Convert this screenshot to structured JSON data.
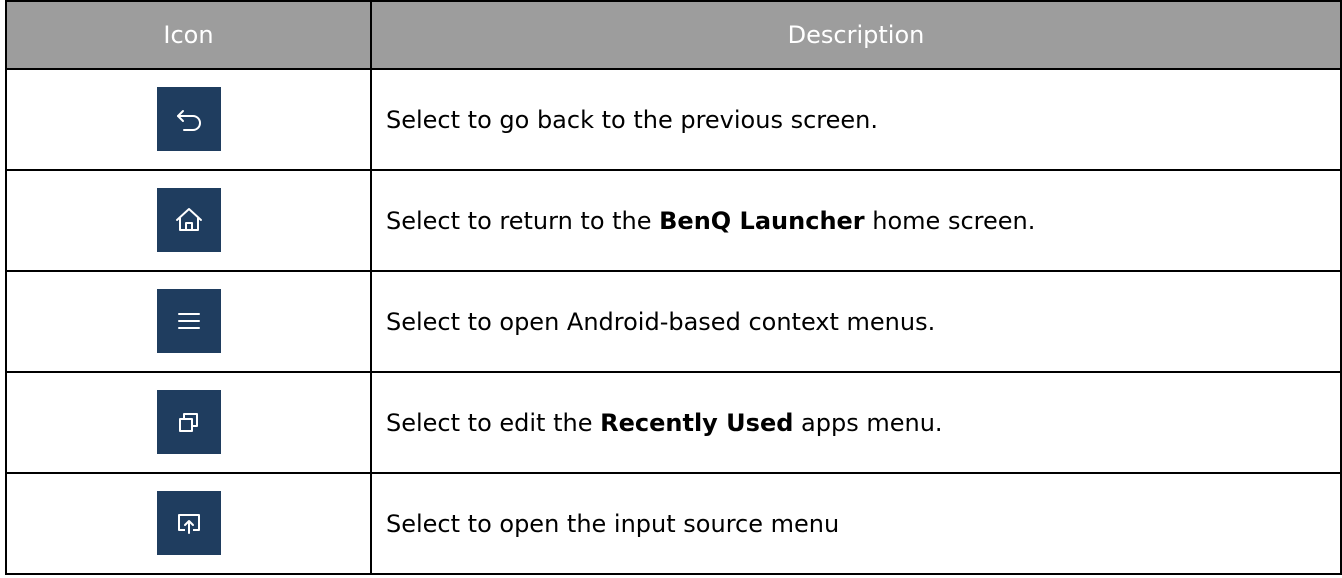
{
  "table": {
    "headers": {
      "icon": "Icon",
      "description": "Description"
    },
    "icon_bg_color": "#1f3d5f",
    "rows": [
      {
        "icon": "back-icon",
        "desc_pre": "Select to go back to the previous screen.",
        "desc_bold": "",
        "desc_post": ""
      },
      {
        "icon": "home-icon",
        "desc_pre": "Select to return to the ",
        "desc_bold": "BenQ Launcher",
        "desc_post": " home screen."
      },
      {
        "icon": "menu-icon",
        "desc_pre": "Select to open Android-based context menus.",
        "desc_bold": "",
        "desc_post": ""
      },
      {
        "icon": "recent-apps-icon",
        "desc_pre": "Select to edit the ",
        "desc_bold": "Recently Used",
        "desc_post": " apps menu."
      },
      {
        "icon": "input-source-icon",
        "desc_pre": "Select to open the input source menu",
        "desc_bold": "",
        "desc_post": ""
      }
    ]
  }
}
